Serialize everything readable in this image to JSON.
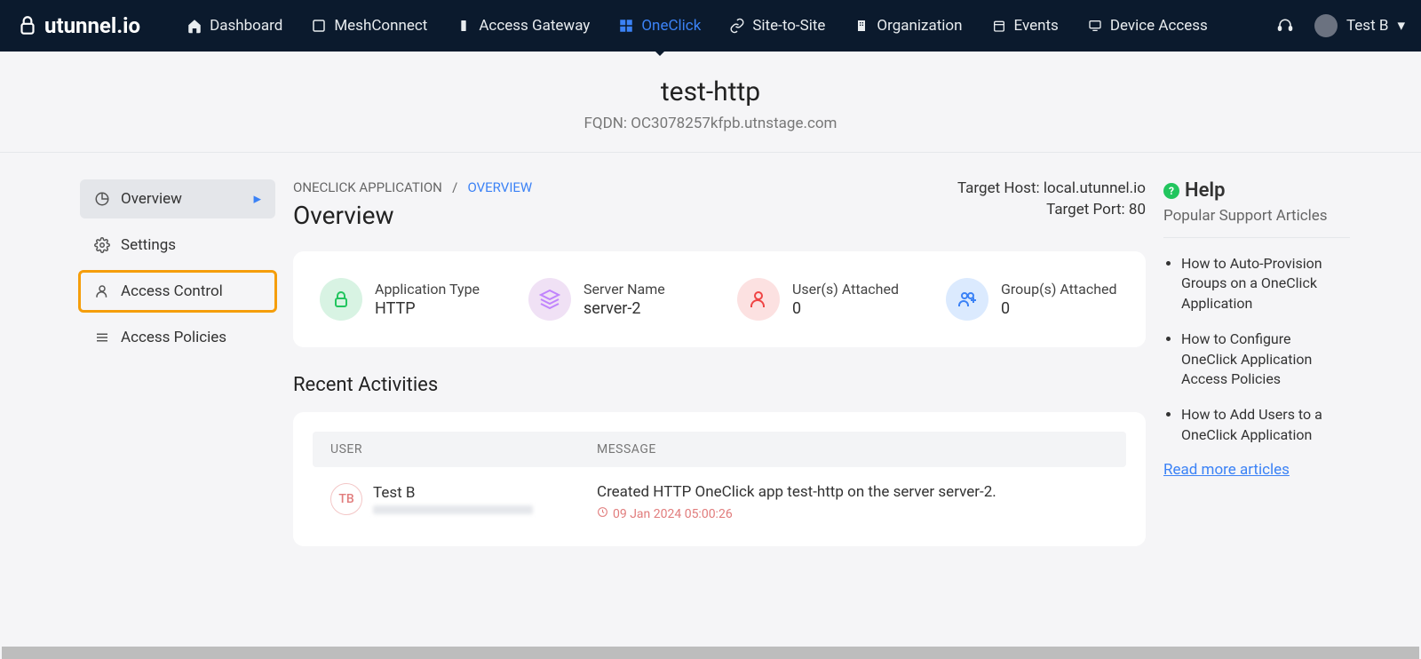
{
  "brand": "utunnel.io",
  "nav": {
    "dashboard": "Dashboard",
    "meshconnect": "MeshConnect",
    "accessgateway": "Access Gateway",
    "oneclick": "OneClick",
    "sitetosite": "Site-to-Site",
    "organization": "Organization",
    "events": "Events",
    "deviceaccess": "Device Access"
  },
  "account": {
    "name": "Test B"
  },
  "header": {
    "title": "test-http",
    "fqdn_label": "FQDN:",
    "fqdn_value": "OC3078257kfpb.utnstage.com"
  },
  "sidebar": {
    "overview": "Overview",
    "settings": "Settings",
    "access_control": "Access Control",
    "access_policies": "Access Policies"
  },
  "breadcrumb": {
    "parent": "ONECLICK APPLICATION",
    "sep": "/",
    "current": "OVERVIEW"
  },
  "page_title": "Overview",
  "targets": {
    "host_label": "Target Host:",
    "host_value": "local.utunnel.io",
    "port_label": "Target Port:",
    "port_value": "80"
  },
  "stats": {
    "app_type": {
      "label": "Application Type",
      "value": "HTTP"
    },
    "server_name": {
      "label": "Server Name",
      "value": "server-2"
    },
    "users_attached": {
      "label": "User(s) Attached",
      "value": "0"
    },
    "groups_attached": {
      "label": "Group(s) Attached",
      "value": "0"
    }
  },
  "recent": {
    "title": "Recent Activities",
    "col_user": "USER",
    "col_message": "MESSAGE",
    "row": {
      "avatar": "TB",
      "user": "Test B",
      "message": "Created HTTP OneClick app test-http on the server server-2.",
      "time": "09 Jan 2024 05:00:26"
    }
  },
  "help": {
    "title": "Help",
    "subtitle": "Popular Support Articles",
    "items": [
      "How to Auto-Provision Groups on a OneClick Application",
      "How to Configure OneClick Application Access Policies",
      "How to Add Users to a OneClick Application"
    ],
    "read_more": "Read more articles"
  }
}
